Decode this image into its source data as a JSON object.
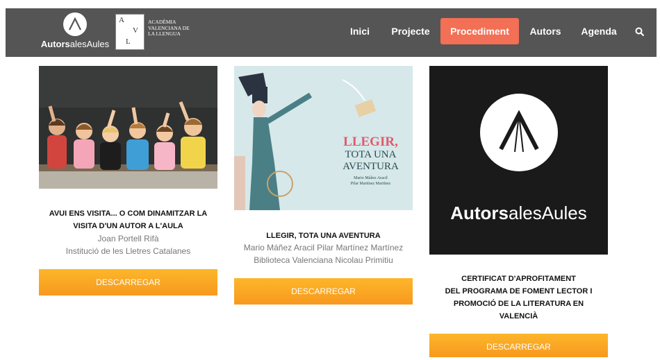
{
  "header": {
    "logo_bold": "Autors",
    "logo_light": "alesAules",
    "avl_letters": [
      "A",
      "V",
      "L"
    ],
    "avl_name": "ACADÈMIA VALENCIANA DE LA LLENGUA",
    "menu": [
      {
        "label": "Inici",
        "active": false
      },
      {
        "label": "Projecte",
        "active": false
      },
      {
        "label": "Procediment",
        "active": true
      },
      {
        "label": "Autors",
        "active": false
      },
      {
        "label": "Agenda",
        "active": false
      }
    ],
    "search_icon": "search-icon"
  },
  "cards": [
    {
      "title_lines": [
        "AVUI ENS VISITA... O COM DINAMITZAR LA",
        "VISITA D'UN AUTOR A L'AULA"
      ],
      "author": "Joan Portell Rifà",
      "institution": "Institució de les Lletres Catalanes",
      "button": "DESCARREGAR"
    },
    {
      "cover_title_1": "LLEGIR,",
      "cover_title_2": "TOTA UNA",
      "cover_title_3": "AVENTURA",
      "cover_authors_1": "Mario Máñez Aracil",
      "cover_authors_2": "Pilar Martínez Martínez",
      "title_lines": [
        "LLEGIR, TOTA UNA AVENTURA"
      ],
      "author": "Mario Máñez Aracil Pilar Martínez Martínez",
      "institution": "Biblioteca Valenciana Nicolau Primitiu",
      "button": "DESCARREGAR"
    },
    {
      "cover_bold": "Autors",
      "cover_light": "alesAules",
      "title_lines": [
        "CERTIFICAT D'APROFITAMENT",
        "DEL PROGRAMA DE FOMENT LECTOR I",
        "PROMOCIÓ DE LA LITERATURA EN",
        "VALENCIÀ"
      ],
      "button": "DESCARREGAR"
    }
  ],
  "colors": {
    "nav_bg": "#555555",
    "active_menu": "#f36f55",
    "button": "#f9a825"
  }
}
